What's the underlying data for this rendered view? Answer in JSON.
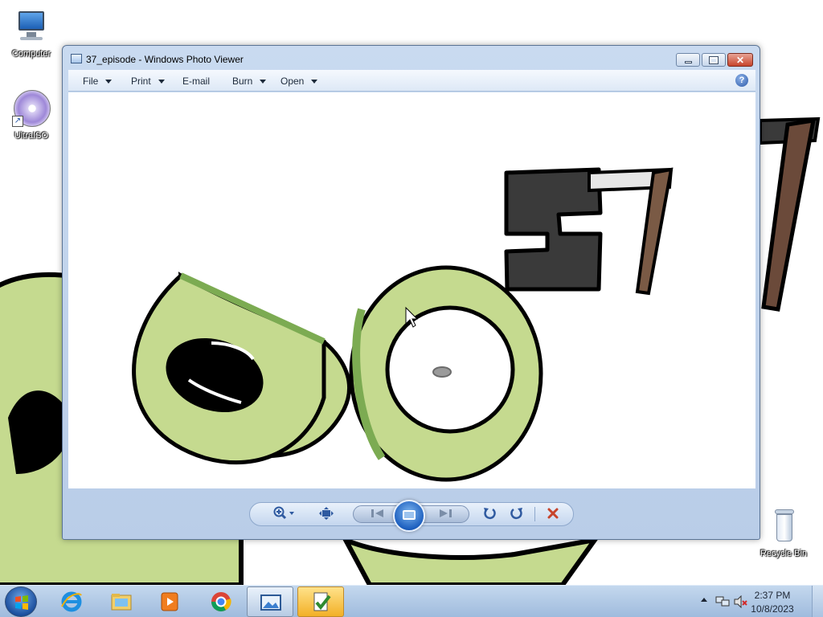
{
  "desktop": {
    "icons": [
      {
        "label": "Computer",
        "icon": "computer-icon"
      },
      {
        "label": "UltraISO",
        "icon": "ultraiso-disc-icon"
      },
      {
        "label": "Recycle Bin",
        "icon": "recycle-bin-icon"
      }
    ]
  },
  "viewer": {
    "title": "37_episode - Windows Photo Viewer",
    "menu": [
      {
        "label": "File",
        "has_dropdown": true
      },
      {
        "label": "Print",
        "has_dropdown": true
      },
      {
        "label": "E-mail",
        "has_dropdown": false
      },
      {
        "label": "Burn",
        "has_dropdown": true
      },
      {
        "label": "Open",
        "has_dropdown": true
      }
    ],
    "help_label": "?",
    "image_text": "37",
    "controls": [
      "zoom-icon",
      "actual-size-icon",
      "previous-icon",
      "slideshow-icon",
      "next-icon",
      "rotate-counterclockwise-icon",
      "rotate-clockwise-icon",
      "delete-icon"
    ]
  },
  "taskbar": {
    "apps": [
      "internet-explorer-icon",
      "windows-explorer-icon",
      "media-player-icon",
      "chrome-icon",
      "photo-viewer-icon",
      "checklist-app-icon"
    ],
    "clock": {
      "time": "2:37 PM",
      "date": "10/8/2023"
    }
  },
  "colors": {
    "accent_green": "#c5da8f",
    "dark_green": "#7cab52",
    "close_red": "#c7442b"
  }
}
